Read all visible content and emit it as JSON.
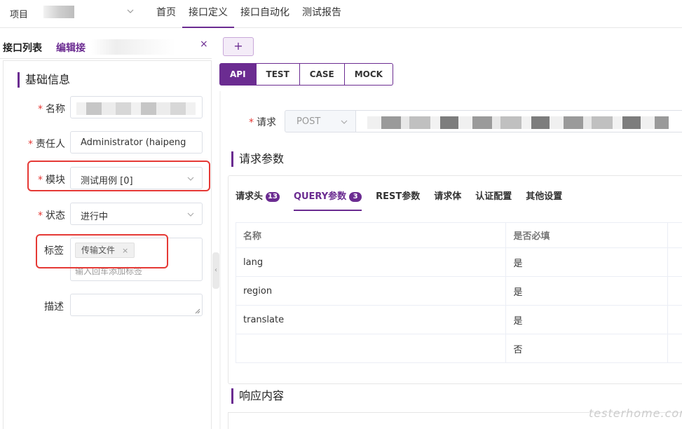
{
  "topnav": {
    "project_label": "项目",
    "tabs": [
      {
        "label": "首页",
        "active": false
      },
      {
        "label": "接口定义",
        "active": true
      },
      {
        "label": "接口自动化",
        "active": false
      },
      {
        "label": "测试报告",
        "active": false
      }
    ]
  },
  "left_tabs": {
    "list_label": "接口列表",
    "edit_label": "编辑接",
    "close_glyph": "×"
  },
  "basic_info": {
    "title": "基础信息",
    "name_label": "名称",
    "owner_label": "责任人",
    "owner_value": "Administrator (haipeng.d",
    "module_label": "模块",
    "module_value": "测试用例 [0]",
    "status_label": "状态",
    "status_value": "进行中",
    "tags_label": "标签",
    "tag_chip": "传输文件",
    "tag_chip_close": "×",
    "tags_placeholder": "输入回车添加标签",
    "desc_label": "描述",
    "required_mark": "*"
  },
  "right": {
    "add_tab_glyph": "+",
    "type_tabs": [
      {
        "label": "API",
        "active": true
      },
      {
        "label": "TEST",
        "active": false
      },
      {
        "label": "CASE",
        "active": false
      },
      {
        "label": "MOCK",
        "active": false
      }
    ],
    "request_label": "请求",
    "method": "POST",
    "params_title": "请求参数",
    "param_tabs": [
      {
        "label": "请求头",
        "badge": "13",
        "active": false
      },
      {
        "label": "QUERY参数",
        "badge": "3",
        "active": true
      },
      {
        "label": "REST参数",
        "badge": "",
        "active": false
      },
      {
        "label": "请求体",
        "badge": "",
        "active": false
      },
      {
        "label": "认证配置",
        "badge": "",
        "active": false
      },
      {
        "label": "其他设置",
        "badge": "",
        "active": false
      }
    ],
    "table_headers": [
      "名称",
      "是否必填"
    ],
    "table_rows": [
      [
        "lang",
        "是"
      ],
      [
        "region",
        "是"
      ],
      [
        "translate",
        "是"
      ],
      [
        "",
        "否"
      ]
    ],
    "response_title": "响应内容"
  },
  "watermark": "testerhome.com",
  "colors": {
    "accent": "#6b2c91",
    "highlight_box": "#e53935"
  }
}
